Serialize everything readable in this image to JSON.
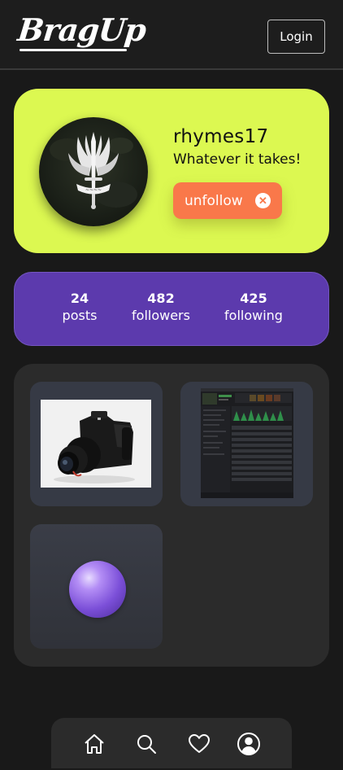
{
  "header": {
    "logo_text": "BragUp",
    "login_label": "Login"
  },
  "profile": {
    "username": "rhymes17",
    "bio": "Whatever it takes!",
    "unfollow_label": "unfollow",
    "avatar_icon": "winged-dagger-emblem-icon",
    "card_color": "#dcf851",
    "button_color": "#f9784a"
  },
  "stats": {
    "posts": {
      "count": "24",
      "label": "posts"
    },
    "followers": {
      "count": "482",
      "label": "followers"
    },
    "following": {
      "count": "425",
      "label": "following"
    },
    "card_color": "#5c3aad"
  },
  "posts": [
    {
      "kind": "photo",
      "subject": "camera"
    },
    {
      "kind": "photo",
      "subject": "dark-app-screenshot"
    },
    {
      "kind": "photo",
      "subject": "purple-sphere"
    }
  ],
  "bottom_nav": {
    "items": [
      "home-icon",
      "search-icon",
      "heart-icon",
      "profile-icon"
    ]
  }
}
